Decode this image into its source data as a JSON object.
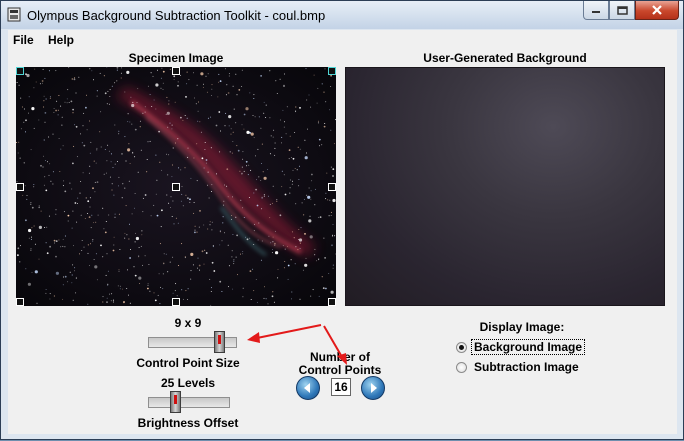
{
  "window": {
    "title": "Olympus Background Subtraction Toolkit - coul.bmp",
    "minimize_icon": "minimize-icon",
    "maximize_icon": "maximize-icon",
    "close_icon": "close-icon"
  },
  "menu": {
    "file": "File",
    "help": "Help"
  },
  "specimen": {
    "header": "Specimen Image"
  },
  "background": {
    "header": "User-Generated Background"
  },
  "controls": {
    "cp_size_value": "9 x 9",
    "cp_size_label": "Control Point Size",
    "cp_size_level": 0.85,
    "brightness_value": "25 Levels",
    "brightness_label": "Brightness Offset",
    "brightness_level": 0.3,
    "count_label_1": "Number of",
    "count_label_2": "Control Points",
    "count_value": "16",
    "display_label": "Display Image:",
    "option_background": "Background Image",
    "option_subtraction": "Subtraction Image",
    "selected": "Background Image"
  },
  "annotation_color": "#e31a1a"
}
